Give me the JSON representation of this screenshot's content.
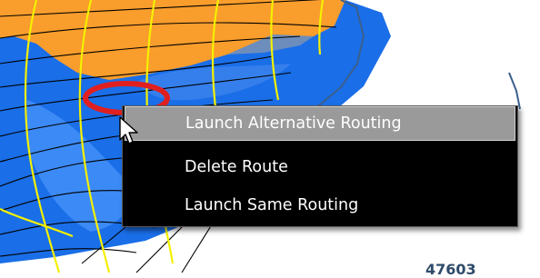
{
  "map": {
    "label": "47603",
    "colors": {
      "terrain_orange": "#f99d2c",
      "water_blue": "#1a6ee8",
      "water_blue_light": "#5aa2ff",
      "contour_yellow": "#f4f000",
      "grid_black": "#000000",
      "outline_blue": "#3b5f8a",
      "selection_ring": "#e02020"
    }
  },
  "context_menu": {
    "items": [
      {
        "label": "Launch Alternative Routing",
        "highlighted": true
      },
      {
        "label": "Delete Route",
        "highlighted": false
      },
      {
        "label": "Launch Same Routing",
        "highlighted": false
      }
    ],
    "colors": {
      "background": "#000000",
      "text": "#ffffff",
      "highlight": "#9a9a9a"
    }
  },
  "cursor": {
    "icon": "arrow-pointer-icon"
  }
}
